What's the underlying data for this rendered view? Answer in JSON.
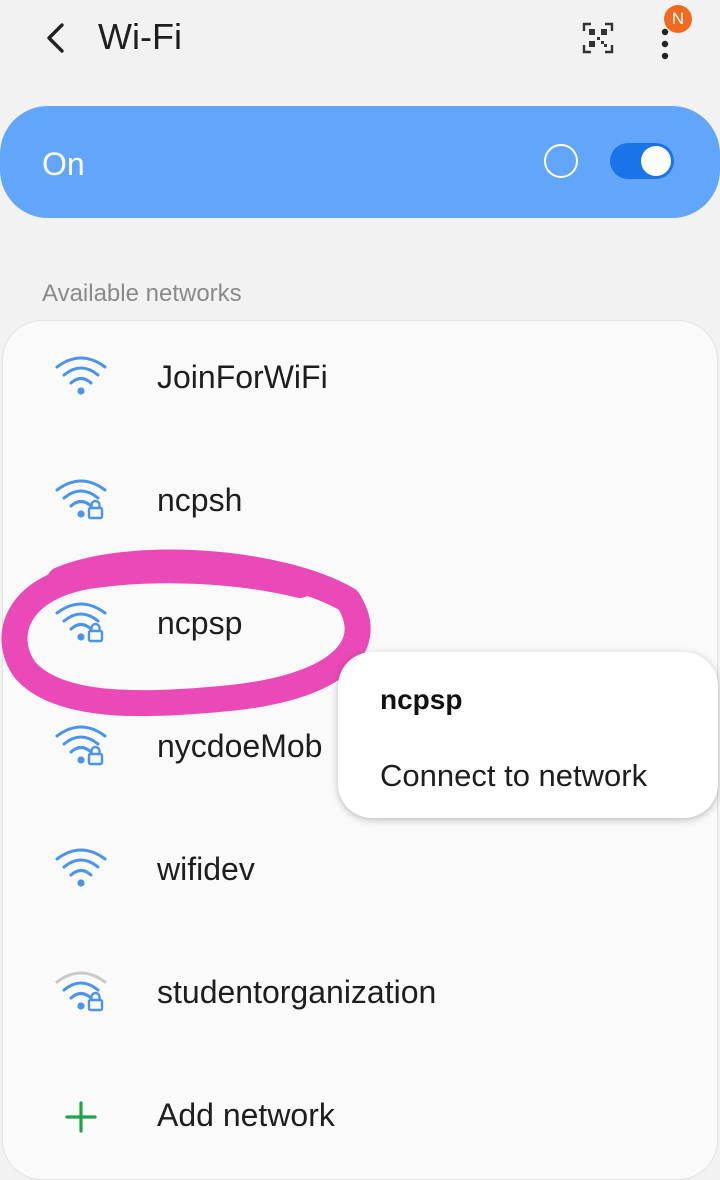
{
  "header": {
    "title": "Wi-Fi",
    "notification_badge": "N",
    "icons": [
      "back-arrow-icon",
      "qr-code-icon",
      "more-options-icon"
    ]
  },
  "wifi_toggle": {
    "label": "On",
    "enabled": true
  },
  "networks_section": {
    "label": "Available networks"
  },
  "networks": [
    {
      "name": "JoinForWiFi",
      "secured": false,
      "signal": "full"
    },
    {
      "name": "ncpsh",
      "secured": true,
      "signal": "full"
    },
    {
      "name": "ncpsp",
      "secured": true,
      "signal": "full"
    },
    {
      "name": "nycdoeMob",
      "secured": true,
      "signal": "full"
    },
    {
      "name": "wifidev",
      "secured": false,
      "signal": "full"
    },
    {
      "name": "studentorganization",
      "secured": true,
      "signal": "weak"
    }
  ],
  "add_network": {
    "label": "Add network"
  },
  "context_menu": {
    "title": "ncpsp",
    "action": "Connect to network"
  },
  "colors": {
    "accent": "#1a73e8",
    "toggle_card": "#62a6fb",
    "wifi_icon": "#4a94ee",
    "annotation": "#e940b4",
    "add_icon": "#1fa34a"
  }
}
